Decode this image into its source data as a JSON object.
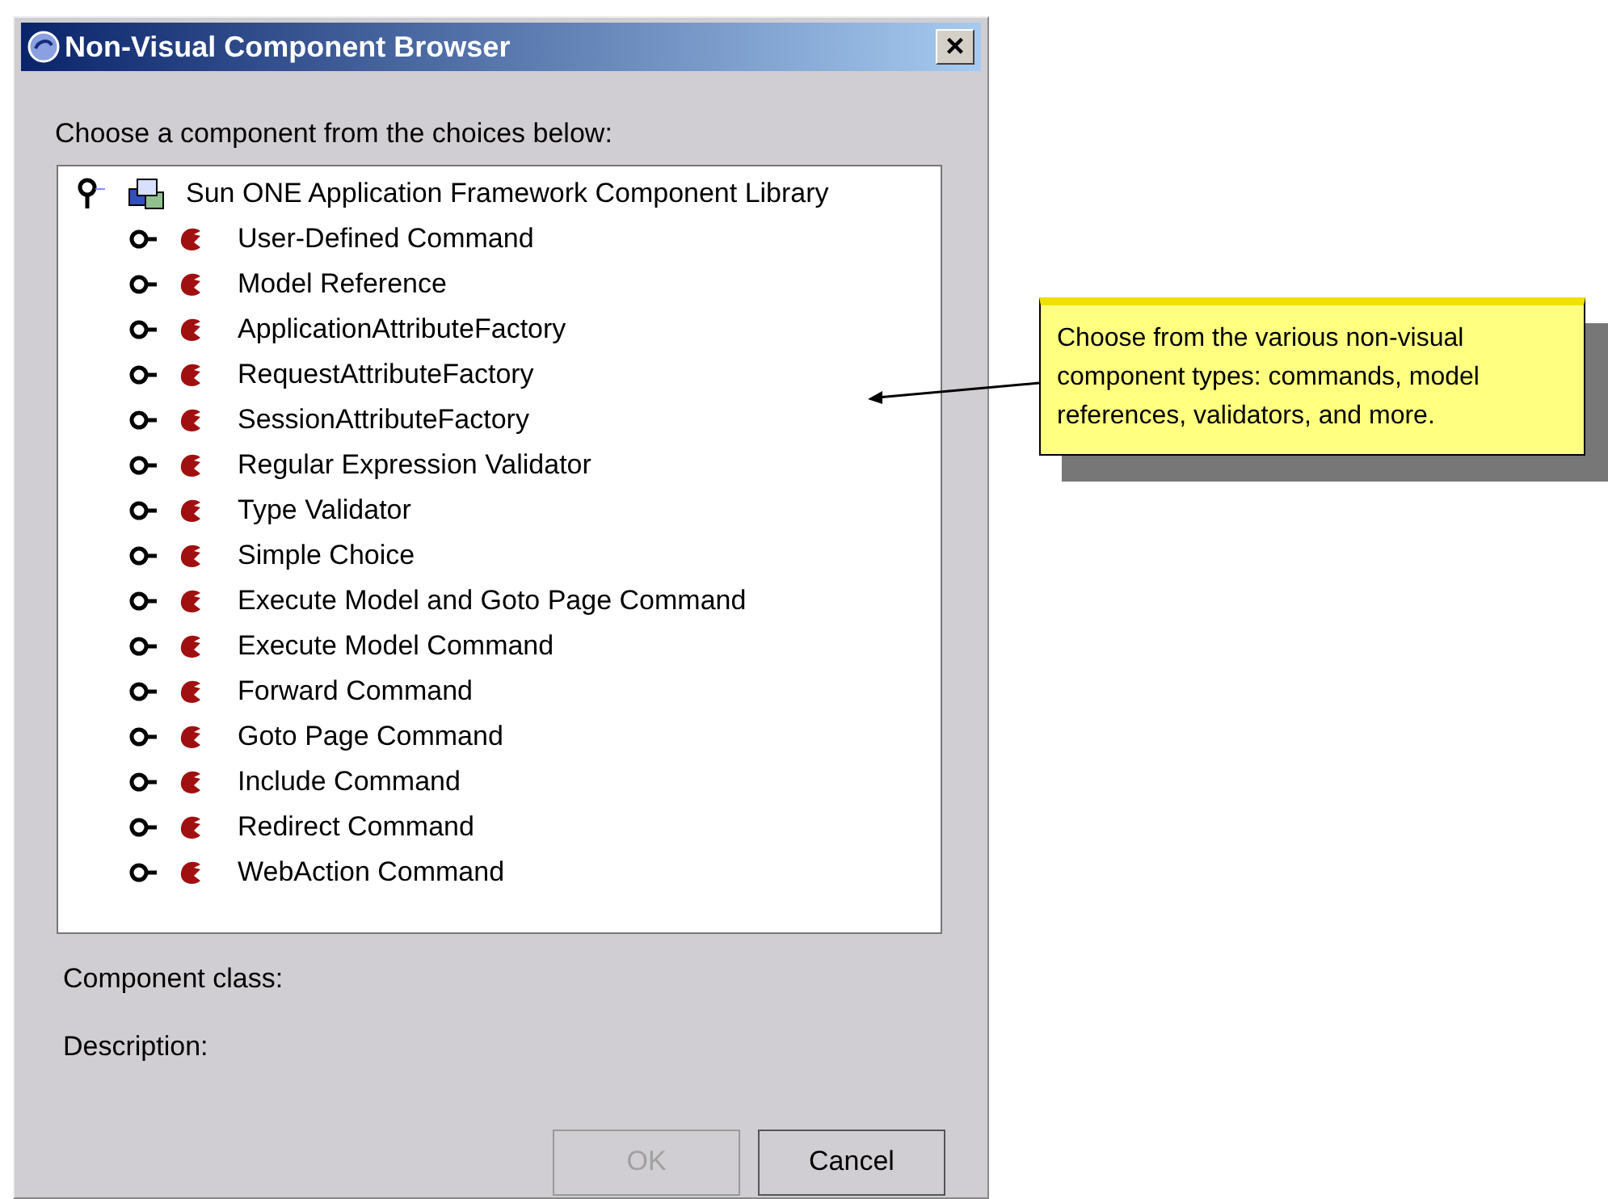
{
  "window": {
    "title": "Non-Visual Component Browser",
    "close": "×"
  },
  "prompt": "Choose a component from the choices below:",
  "tree": [
    {
      "label": "Sun ONE Application Framework Component Library",
      "expanded": true,
      "children": [
        {
          "label": "User-Defined Command",
          "expanded": false
        },
        {
          "label": "Model Reference",
          "expanded": false
        },
        {
          "label": "ApplicationAttributeFactory",
          "expanded": false
        },
        {
          "label": "RequestAttributeFactory",
          "expanded": false
        },
        {
          "label": "SessionAttributeFactory",
          "expanded": false
        },
        {
          "label": "Regular Expression Validator",
          "expanded": false
        },
        {
          "label": "Type Validator",
          "expanded": false
        },
        {
          "label": "Simple Choice",
          "expanded": false
        },
        {
          "label": "Execute Model and Goto Page Command",
          "expanded": false
        },
        {
          "label": "Execute Model Command",
          "expanded": false
        },
        {
          "label": "Forward Command",
          "expanded": false
        },
        {
          "label": "Goto Page Command",
          "expanded": false
        },
        {
          "label": "Include Command",
          "expanded": false
        },
        {
          "label": "Redirect Command",
          "expanded": false
        },
        {
          "label": "WebAction Command",
          "expanded": false
        }
      ]
    }
  ],
  "details": [
    "Component class:",
    "Description:"
  ],
  "buttons": [
    {
      "label": "OK",
      "disabled": true
    },
    {
      "label": "Cancel",
      "disabled": false
    }
  ],
  "callout": {
    "text": "Choose from the various non-visual component types: commands, model references, validators, and more."
  }
}
